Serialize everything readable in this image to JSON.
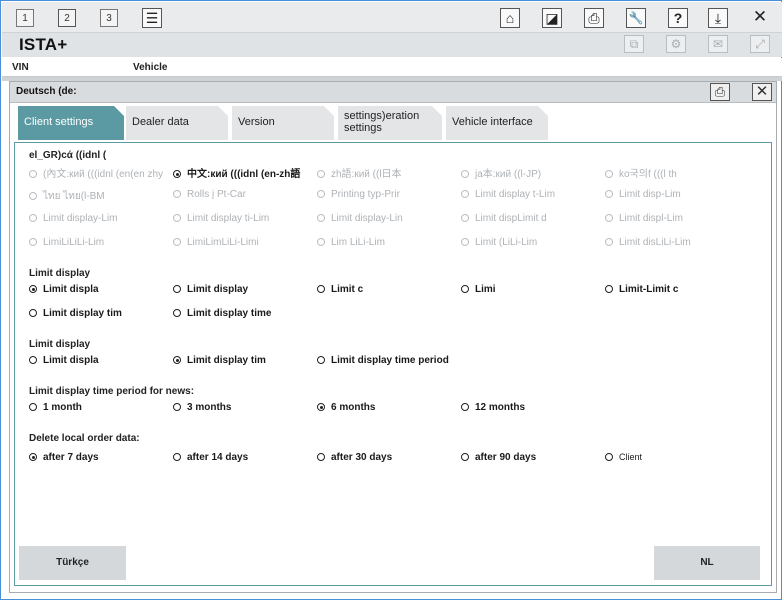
{
  "topbar": {
    "tabs": [
      "1",
      "2",
      "3"
    ],
    "icons": [
      "list-icon",
      "home-icon",
      "picture-in-picture-icon",
      "print-icon",
      "wrench-icon",
      "help-icon",
      "download-icon",
      "close-icon"
    ],
    "icon_glyphs": {
      "home": "⌂",
      "pip": "◪",
      "print": "⎙",
      "wrench": "🔧",
      "help": "?",
      "download": "⤓",
      "close": "✕",
      "list": "☰"
    }
  },
  "app": {
    "title": "ISTA+"
  },
  "titlebar_glyphs": {
    "doc": "⧉",
    "gear": "⚙",
    "mail": "✉",
    "expand": "⤢"
  },
  "infobar": {
    "vin_label": "VIN",
    "vehicle_label": "Vehicle"
  },
  "dialog": {
    "title": "Deutsch (de:",
    "print_glyph": "⎙",
    "close_glyph": "✕",
    "tabs": [
      "Client settings",
      "Dealer data",
      "Version",
      "settings)eration settings",
      "Vehicle interface"
    ],
    "tab3_line1": "settings)eration",
    "tab3_line2": "settings",
    "language": {
      "label": "el_GR)cά ((idnl (",
      "options": [
        [
          "(內文:кий (((idnl (en(en zhy",
          "中文:кий (((idnl  (en-zh語",
          "zh語:кий ((l日本",
          "ja本:кий ((l-JP)",
          "ko국의f (((l th"
        ],
        [
          "ไทย ไทย(l-BM",
          "Rolls į Pt-Car",
          "Printing typ-Prir",
          "Limit display t-Lim",
          "Limit disp-Lim"
        ],
        [
          "Limit display-Lim",
          "Limit display ti-Lim",
          "Limit display-Lin",
          "Limit dispLimit d",
          "Limit displ-Lim"
        ],
        [
          "LimiLiLiLi-Lim",
          "LimiLimLiLi-Limi",
          "Lim LiLi-Lim",
          "Limit (LiLi-Lim",
          "Limit disLiLi-Lim"
        ]
      ]
    },
    "section2": {
      "label": "Limit display",
      "row1": [
        "Limit displa",
        "Limit display",
        "Limit c",
        "Limi",
        "Limit-Limit c"
      ],
      "row2": [
        "Limit display tim",
        "Limit display time"
      ]
    },
    "section3": {
      "label": "Limit display",
      "options": [
        "Limit displa",
        "Limit display tim",
        "Limit display time period"
      ]
    },
    "section4": {
      "label": "Limit display time period for news:",
      "options": [
        "1 month",
        "3 months",
        "6 months",
        "12 months"
      ]
    },
    "section5": {
      "label": "Delete local order data:",
      "options": [
        "after 7 days",
        "after 14 days",
        "after 30 days",
        "after 90 days",
        "Client"
      ]
    },
    "footer": {
      "left_button": "Türkçe",
      "right_button": "NL"
    }
  }
}
